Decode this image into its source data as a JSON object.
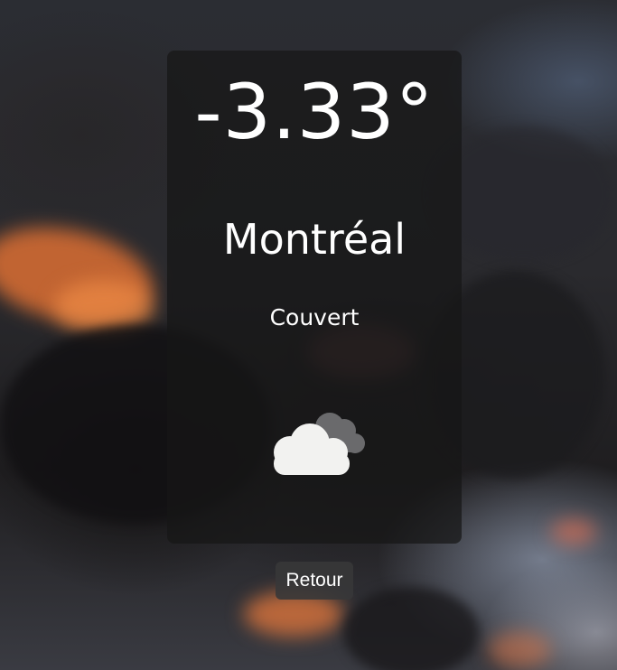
{
  "weather": {
    "temperature": "-3.33°",
    "city": "Montréal",
    "condition": "Couvert",
    "icon": "cloudy-icon"
  },
  "actions": {
    "back_label": "Retour"
  },
  "colors": {
    "card_background": "#161616",
    "text": "#ffffff",
    "cloud_front": "#f2f2f0",
    "cloud_back": "#6a6a6c",
    "button_background": "#373739"
  }
}
